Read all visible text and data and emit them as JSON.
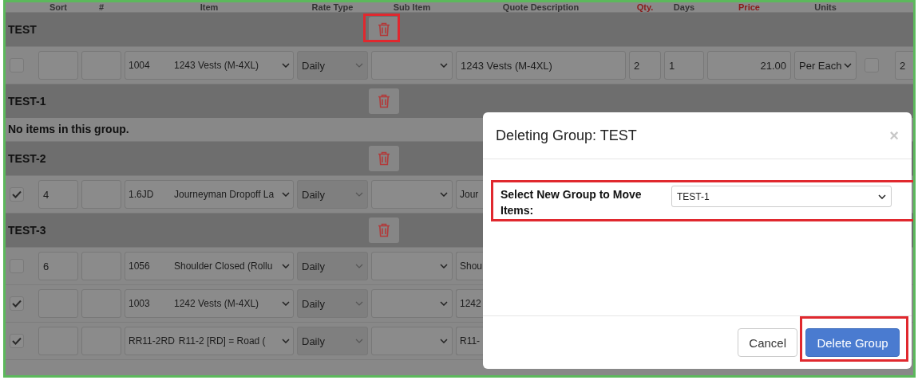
{
  "columns": [
    {
      "label": "Sort",
      "required": false
    },
    {
      "label": "#",
      "required": false
    },
    {
      "label": "Item",
      "required": false
    },
    {
      "label": "Rate Type",
      "required": false
    },
    {
      "label": "Sub Item",
      "required": false
    },
    {
      "label": "Quote Description",
      "required": false
    },
    {
      "label": "Qty.",
      "required": true
    },
    {
      "label": "Days",
      "required": false
    },
    {
      "label": "Price",
      "required": true
    },
    {
      "label": "Units",
      "required": false
    }
  ],
  "groups": [
    {
      "name": "TEST",
      "highlighted": true,
      "items": [
        {
          "checked": false,
          "code": "1004",
          "name": "1243 Vests (M-4XL)",
          "rate_type": "Daily",
          "description": "1243 Vests (M-4XL)",
          "qty": "2",
          "days": "1",
          "price": "21.00",
          "units": "Per Each",
          "extra_checked": false,
          "column_13": "2"
        }
      ]
    },
    {
      "name": "TEST-1",
      "highlighted": false,
      "empty_message": "No items in this group."
    },
    {
      "name": "TEST-2",
      "highlighted": false,
      "items": [
        {
          "checked": true,
          "sort": "4",
          "code": "1.6JD",
          "name": "Journeyman Dropoff La",
          "rate_type": "Daily",
          "description": "Jour"
        }
      ]
    },
    {
      "name": "TEST-3",
      "highlighted": false,
      "items": [
        {
          "checked": false,
          "sort": "6",
          "code": "1056",
          "name": "Shoulder Closed (Rollu",
          "rate_type": "Daily",
          "description": "Shou"
        },
        {
          "checked": true,
          "code": "1003",
          "name": "1242 Vests (M-4XL)",
          "rate_type": "Daily",
          "description": "1242"
        },
        {
          "checked": true,
          "code": "RR11-2RD",
          "name": "R11-2 [RD] = Road (",
          "rate_type": "Daily",
          "description": "R11-"
        }
      ]
    }
  ],
  "modal": {
    "title": "Deleting Group: TEST",
    "close": "×",
    "field_label": "Select New Group to Move Items:",
    "field_value": "TEST-1",
    "field_highlighted": true,
    "buttons": [
      {
        "label": "Cancel",
        "kind": "default",
        "highlighted": false
      },
      {
        "label": "Delete Group",
        "kind": "primary",
        "highlighted": true
      }
    ]
  }
}
